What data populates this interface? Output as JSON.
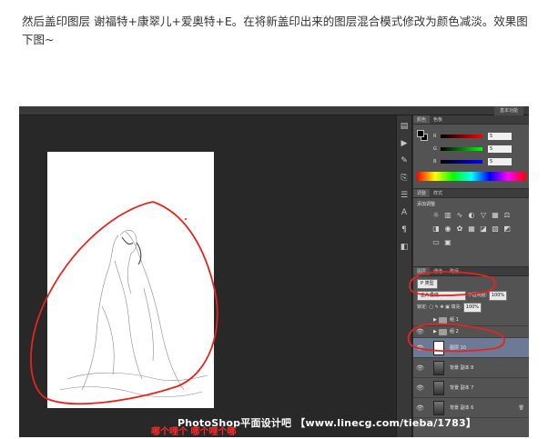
{
  "intro_text": "然后盖印图层 谢福特+康翠儿+爱奥特+E。在将新盖印出来的图层混合模式修改为颜色减淡。效果图下图~",
  "workspace_label": "基本功能",
  "color_panel": {
    "tabs": [
      "颜色",
      "色板"
    ],
    "channels": [
      {
        "label": "R",
        "value": "5"
      },
      {
        "label": "G",
        "value": "5"
      },
      {
        "label": "B",
        "value": "5"
      }
    ]
  },
  "adjustments_panel": {
    "tabs": [
      "调整",
      "样式"
    ],
    "title": "添加调整",
    "icons": [
      "brightness-icon",
      "levels-icon",
      "curves-icon",
      "exposure-icon",
      "vibrance-icon",
      "hue-icon",
      "balance-icon",
      "bw-icon",
      "photo-filter-icon",
      "channel-mixer-icon",
      "lookup-icon",
      "invert-icon",
      "posterize-icon",
      "threshold-icon",
      "gradient-map-icon",
      "selective-color-icon"
    ]
  },
  "layers_panel": {
    "tabs": [
      "图层",
      "通道",
      "路径"
    ],
    "kind_filter": "P 类型",
    "blend_mode": "正片叠底",
    "opacity_label": "不透明度:",
    "opacity_value": "100%",
    "lock_label": "锁定:",
    "fill_label": "填充:",
    "fill_value": "100%",
    "layers": [
      {
        "name": "组 1",
        "type": "group"
      },
      {
        "name": "组 2",
        "type": "group"
      },
      {
        "name": "图层 10",
        "type": "layer",
        "selected": true
      },
      {
        "name": "背景 副本 8",
        "type": "layer"
      },
      {
        "name": "背景 副本 7",
        "type": "layer"
      },
      {
        "name": "背景 副本 6",
        "type": "layer"
      }
    ]
  },
  "watermark": "PhotoShop平面设计吧 【www.linecg.com/tieba/1783】",
  "red_caption": "哪个哩个 哪个哩个哪",
  "colors": {
    "annotation_red": "#e8231f",
    "ps_dark": "#282828",
    "panel_gray": "#535353",
    "selection": "#6d7a96"
  }
}
